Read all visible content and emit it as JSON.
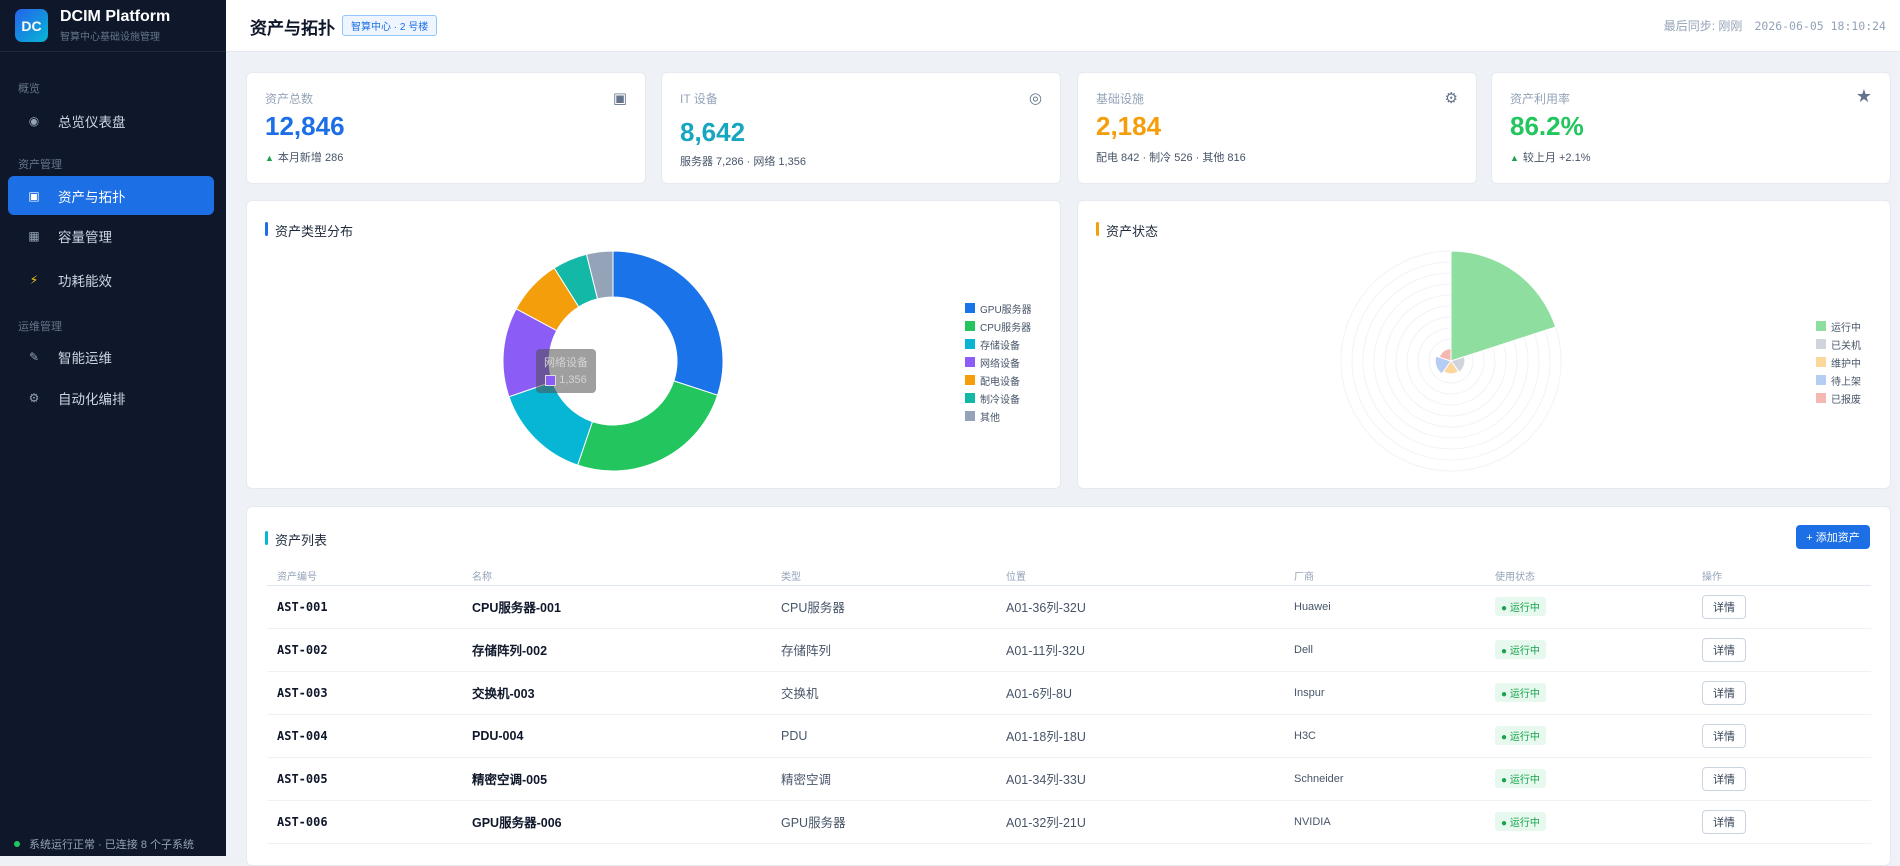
{
  "brand": {
    "logo": "DC",
    "title": "DCIM Platform",
    "subtitle": "智算中心基础设施管理"
  },
  "nav": {
    "sections": [
      "概览",
      "资产管理",
      "运维管理"
    ],
    "items": [
      {
        "label": "总览仪表盘",
        "icon": "target-icon"
      },
      {
        "label": "资产与拓扑",
        "icon": "square-icon",
        "active": true
      },
      {
        "label": "容量管理",
        "icon": "grid-icon"
      },
      {
        "label": "功耗能效",
        "icon": "bolt-icon"
      },
      {
        "label": "智能运维",
        "icon": "wrench-icon"
      },
      {
        "label": "自动化编排",
        "icon": "gear-icon"
      }
    ],
    "status": "系统运行正常 · 已连接 8 个子系统"
  },
  "header": {
    "title": "资产与拓扑",
    "badge": "智算中心 · 2 号楼",
    "sync_label": "最后同步: 刚刚",
    "sync_time": "2026-06-05 18:10:24"
  },
  "kpis": [
    {
      "label": "资产总数",
      "value": "12,846",
      "up": "▲",
      "sub": "本月新增 286",
      "color": "#1d6fe6",
      "icon": "chip-icon"
    },
    {
      "label": "IT 设备",
      "value": "8,642",
      "sub": "服务器 7,286 · 网络 1,356",
      "color": "#17a6c0",
      "icon": "disc-icon"
    },
    {
      "label": "基础设施",
      "value": "2,184",
      "sub": "配电 842 · 制冷 526 · 其他 816",
      "color": "#f59e0b",
      "icon": "gear-icon"
    },
    {
      "label": "资产利用率",
      "value": "86.2%",
      "up": "▲",
      "sub": "较上月 +2.1%",
      "color": "#22c55e",
      "icon": "star-icon"
    }
  ],
  "type_chart": {
    "title": "资产类型分布",
    "tooltip": {
      "name": "网络设备",
      "value": "1,356"
    }
  },
  "status_chart": {
    "title": "资产状态"
  },
  "chart_data": [
    {
      "type": "pie",
      "title": "资产类型分布",
      "categories": [
        "GPU服务器",
        "CPU服务器",
        "存储设备",
        "网络设备",
        "配电设备",
        "制冷设备",
        "其他"
      ],
      "values": [
        3100,
        2600,
        1500,
        1356,
        842,
        526,
        400
      ],
      "colors": [
        "#1a73e8",
        "#22c55e",
        "#06b6d4",
        "#8b5cf6",
        "#f59e0b",
        "#14b8a6",
        "#94a3b8"
      ],
      "legend": "right",
      "donut": true
    },
    {
      "type": "pie",
      "title": "资产状态",
      "categories": [
        "运行中",
        "已关机",
        "维护中",
        "待上架",
        "已报废"
      ],
      "values": [
        10500,
        600,
        500,
        800,
        446
      ],
      "colors": [
        "#8ede9f",
        "#d1d5db",
        "#fcd79c",
        "#b5ccf3",
        "#f5b7b1"
      ],
      "legend": "right",
      "rose": true
    }
  ],
  "table": {
    "title": "资产列表",
    "add_label": "+ 添加资产",
    "columns": [
      "资产编号",
      "名称",
      "类型",
      "位置",
      "厂商",
      "使用状态",
      "操作"
    ],
    "rows": [
      [
        "AST-001",
        "CPU服务器-001",
        "CPU服务器",
        "A01-36列-32U",
        "Huawei",
        "运行中",
        "详情"
      ],
      [
        "AST-002",
        "存储阵列-002",
        "存储阵列",
        "A01-11列-32U",
        "Dell",
        "运行中",
        "详情"
      ],
      [
        "AST-003",
        "交换机-003",
        "交换机",
        "A01-6列-8U",
        "Inspur",
        "运行中",
        "详情"
      ],
      [
        "AST-004",
        "PDU-004",
        "PDU",
        "A01-18列-18U",
        "H3C",
        "运行中",
        "详情"
      ],
      [
        "AST-005",
        "精密空调-005",
        "精密空调",
        "A01-34列-33U",
        "Schneider",
        "运行中",
        "详情"
      ],
      [
        "AST-006",
        "GPU服务器-006",
        "GPU服务器",
        "A01-32列-21U",
        "NVIDIA",
        "运行中",
        "详情"
      ]
    ]
  }
}
